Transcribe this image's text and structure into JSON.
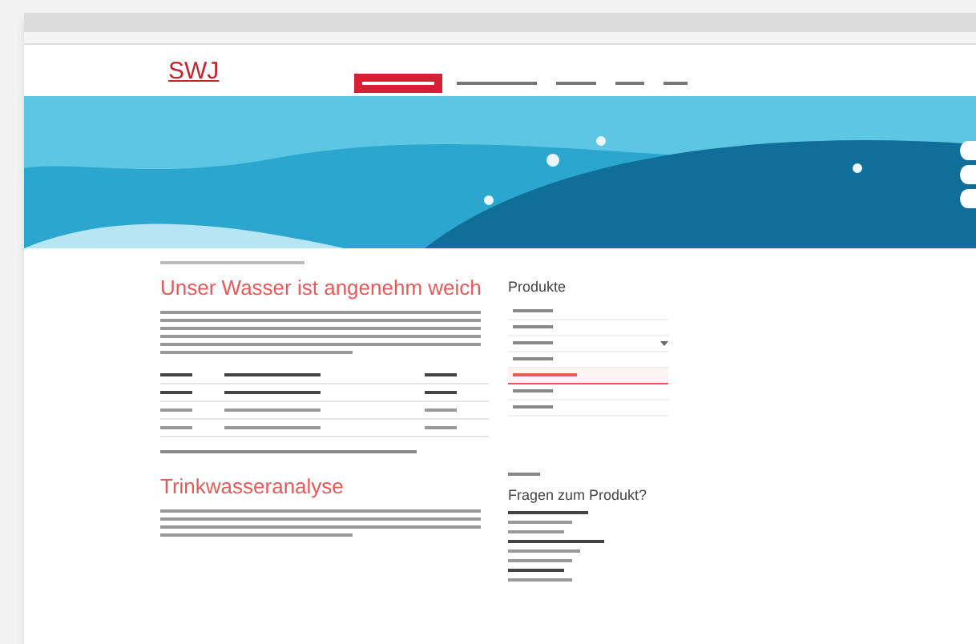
{
  "logo": {
    "text": "SWJ"
  },
  "nav": {
    "items": [
      {
        "selected": true
      },
      {
        "selected": false
      },
      {
        "selected": false
      },
      {
        "selected": false
      },
      {
        "selected": false
      }
    ]
  },
  "main": {
    "heading": "Unser Wasser ist angenehm weich",
    "section_heading": "Trinkwasseranalyse"
  },
  "sidebar": {
    "title": "Produkte",
    "items": [
      {
        "selected": false,
        "has_submenu": false
      },
      {
        "selected": false,
        "has_submenu": false
      },
      {
        "selected": false,
        "has_submenu": true
      },
      {
        "selected": false,
        "has_submenu": false
      },
      {
        "selected": true,
        "has_submenu": false
      },
      {
        "selected": false,
        "has_submenu": false
      },
      {
        "selected": false,
        "has_submenu": false
      }
    ],
    "contact_title": "Fragen zum Produkt?"
  }
}
